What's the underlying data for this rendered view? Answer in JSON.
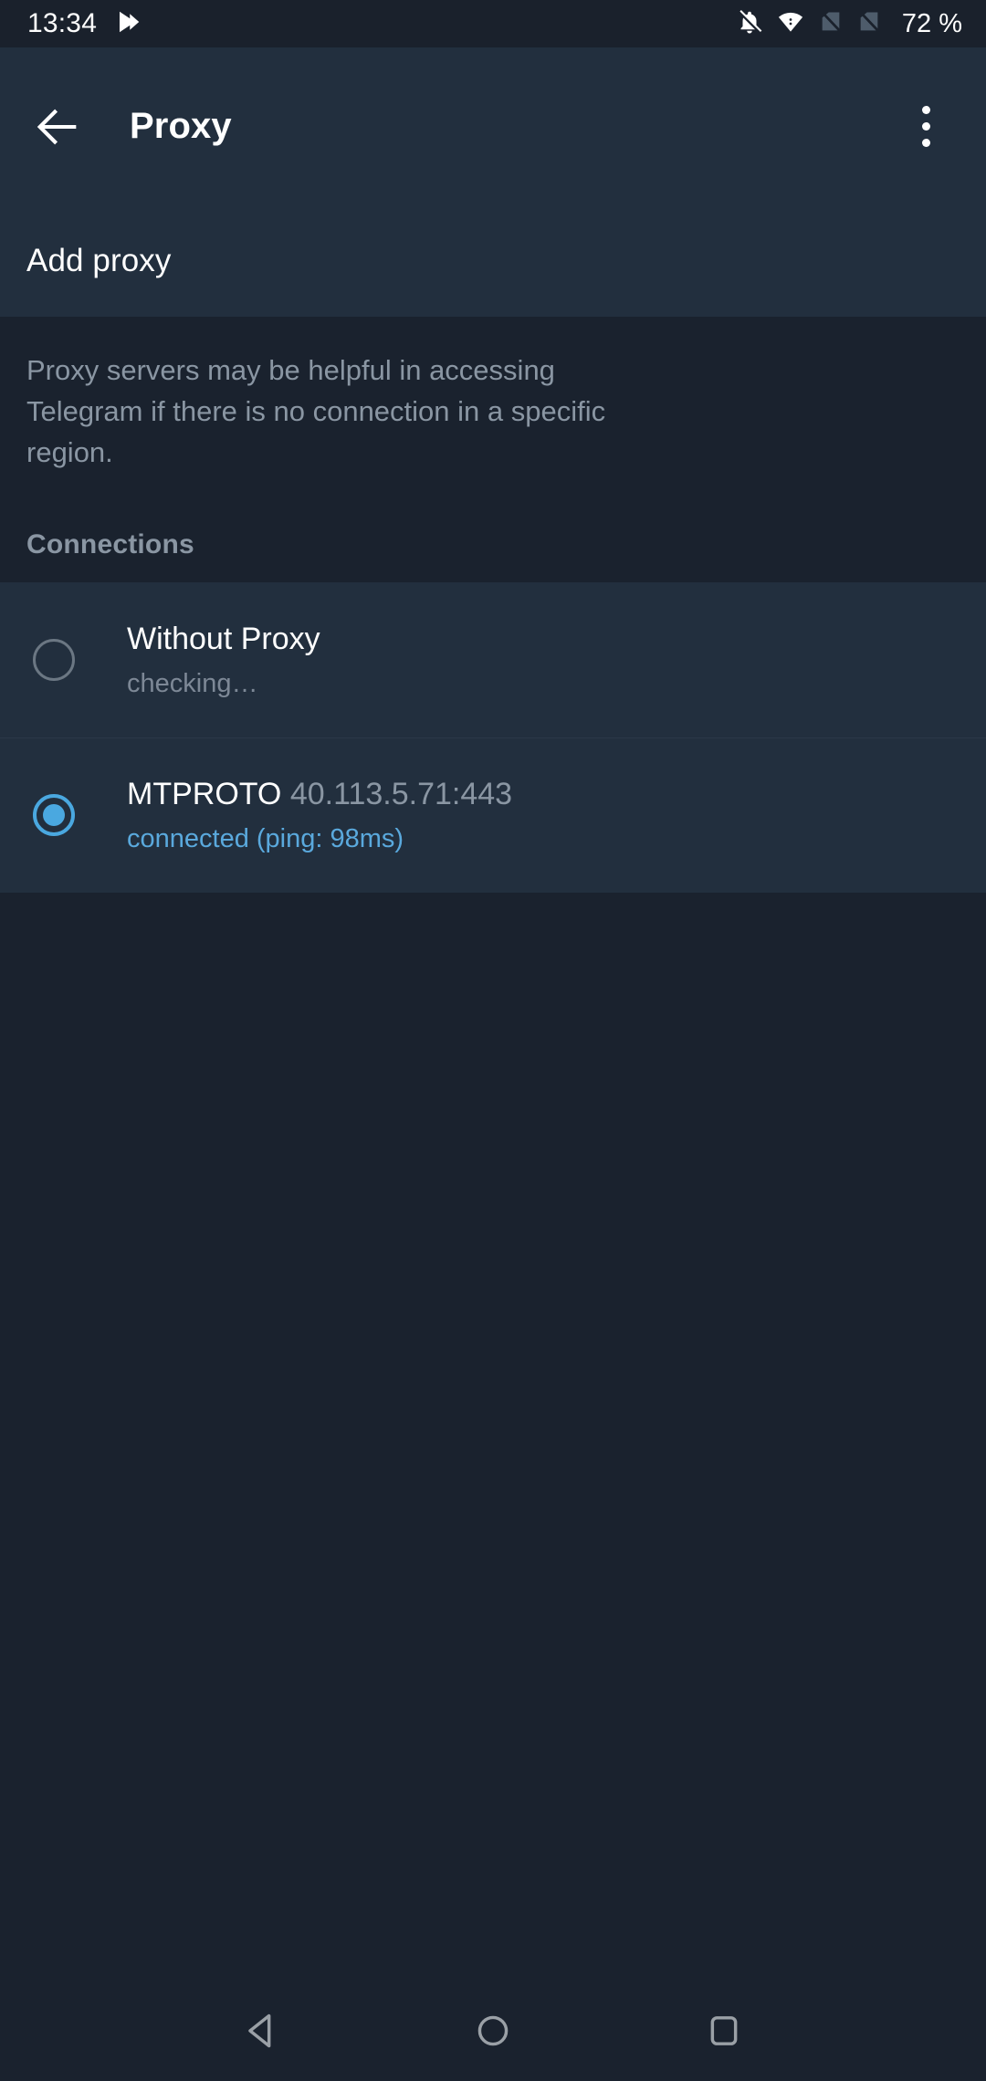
{
  "status_bar": {
    "time": "13:34",
    "battery": "72 %",
    "icons": [
      "app-notification-icon",
      "bell-off-icon",
      "wifi-icon",
      "no-sim-1-icon",
      "no-sim-2-icon"
    ]
  },
  "toolbar": {
    "title": "Proxy",
    "back_icon": "back-arrow-icon",
    "overflow_icon": "overflow-menu-icon"
  },
  "add_proxy": {
    "label": "Add proxy"
  },
  "info": {
    "description": "Proxy servers may be helpful in accessing Telegram if there is no connection in a specific region.",
    "section_header": "Connections"
  },
  "connections": [
    {
      "title": "Without Proxy",
      "address": "",
      "subtitle": "checking…",
      "selected": false,
      "subtitle_state": "muted"
    },
    {
      "title": "MTPROTO",
      "address": "40.113.5.71:443",
      "subtitle": "connected (ping: 98ms)",
      "selected": true,
      "subtitle_state": "active"
    }
  ],
  "nav_bar": {
    "back": "nav-back-icon",
    "home": "nav-home-icon",
    "recents": "nav-recents-icon"
  },
  "colors": {
    "accent": "#4aa8e0",
    "card": "#222f3e",
    "background": "#1a222e",
    "status_bar": "#1a212c",
    "muted_text": "#8a96a3"
  }
}
